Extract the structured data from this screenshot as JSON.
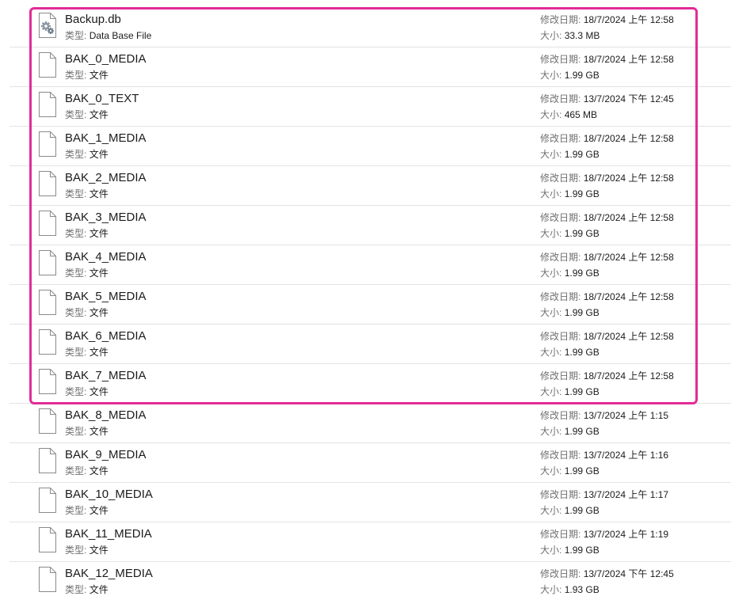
{
  "labels": {
    "type": "类型:",
    "modified": "修改日期:",
    "size": "大小:"
  },
  "highlight": {
    "color": "#e22b97",
    "covers_rows": 10
  },
  "files": [
    {
      "name": "Backup.db",
      "type": "Data Base File",
      "modified": "18/7/2024 上午 12:58",
      "size": "33.3 MB",
      "icon": "settings-file-icon"
    },
    {
      "name": "BAK_0_MEDIA",
      "type": "文件",
      "modified": "18/7/2024 上午 12:58",
      "size": "1.99 GB",
      "icon": "file-icon"
    },
    {
      "name": "BAK_0_TEXT",
      "type": "文件",
      "modified": "13/7/2024 下午 12:45",
      "size": "465 MB",
      "icon": "file-icon"
    },
    {
      "name": "BAK_1_MEDIA",
      "type": "文件",
      "modified": "18/7/2024 上午 12:58",
      "size": "1.99 GB",
      "icon": "file-icon"
    },
    {
      "name": "BAK_2_MEDIA",
      "type": "文件",
      "modified": "18/7/2024 上午 12:58",
      "size": "1.99 GB",
      "icon": "file-icon"
    },
    {
      "name": "BAK_3_MEDIA",
      "type": "文件",
      "modified": "18/7/2024 上午 12:58",
      "size": "1.99 GB",
      "icon": "file-icon"
    },
    {
      "name": "BAK_4_MEDIA",
      "type": "文件",
      "modified": "18/7/2024 上午 12:58",
      "size": "1.99 GB",
      "icon": "file-icon"
    },
    {
      "name": "BAK_5_MEDIA",
      "type": "文件",
      "modified": "18/7/2024 上午 12:58",
      "size": "1.99 GB",
      "icon": "file-icon"
    },
    {
      "name": "BAK_6_MEDIA",
      "type": "文件",
      "modified": "18/7/2024 上午 12:58",
      "size": "1.99 GB",
      "icon": "file-icon"
    },
    {
      "name": "BAK_7_MEDIA",
      "type": "文件",
      "modified": "18/7/2024 上午 12:58",
      "size": "1.99 GB",
      "icon": "file-icon"
    },
    {
      "name": "BAK_8_MEDIA",
      "type": "文件",
      "modified": "13/7/2024 上午 1:15",
      "size": "1.99 GB",
      "icon": "file-icon"
    },
    {
      "name": "BAK_9_MEDIA",
      "type": "文件",
      "modified": "13/7/2024 上午 1:16",
      "size": "1.99 GB",
      "icon": "file-icon"
    },
    {
      "name": "BAK_10_MEDIA",
      "type": "文件",
      "modified": "13/7/2024 上午 1:17",
      "size": "1.99 GB",
      "icon": "file-icon"
    },
    {
      "name": "BAK_11_MEDIA",
      "type": "文件",
      "modified": "13/7/2024 上午 1:19",
      "size": "1.99 GB",
      "icon": "file-icon"
    },
    {
      "name": "BAK_12_MEDIA",
      "type": "文件",
      "modified": "13/7/2024 下午 12:45",
      "size": "1.93 GB",
      "icon": "file-icon"
    }
  ]
}
